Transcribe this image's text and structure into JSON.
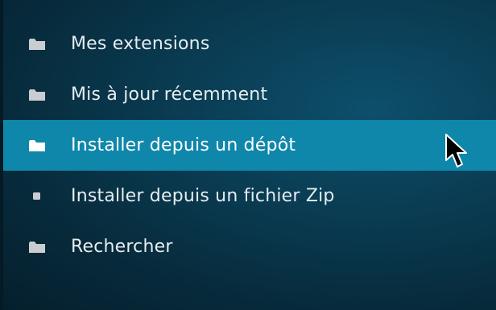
{
  "menu": {
    "items": [
      {
        "label": "Mes extensions",
        "icon": "folder-icon"
      },
      {
        "label": "Mis à jour récemment",
        "icon": "folder-icon"
      },
      {
        "label": "Installer depuis un dépôt",
        "icon": "folder-icon",
        "selected": true
      },
      {
        "label": "Installer depuis un fichier Zip",
        "icon": "square-icon"
      },
      {
        "label": "Rechercher",
        "icon": "folder-icon"
      }
    ]
  },
  "colors": {
    "background": "#0a3d54",
    "selected_row": "#0f87aa",
    "text": "#e6edf1",
    "icon": "#c9cdd1"
  }
}
